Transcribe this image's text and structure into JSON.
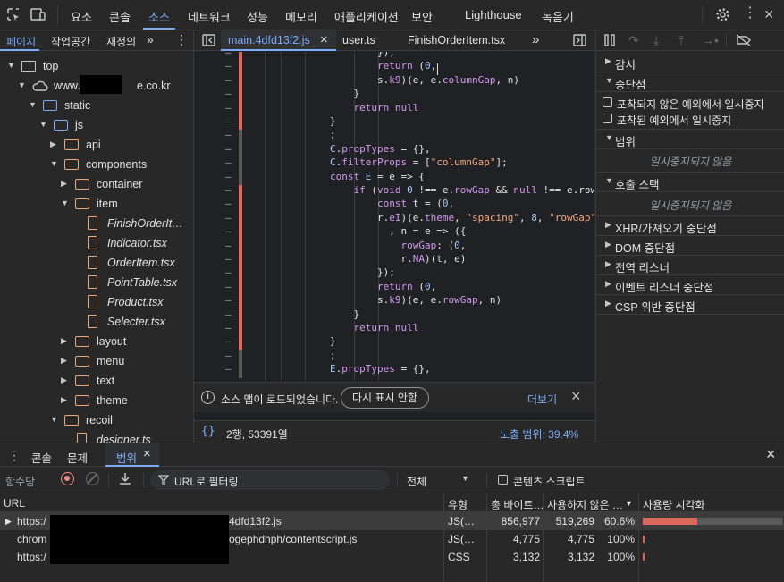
{
  "topbar": {
    "tabs": [
      "요소",
      "콘솔",
      "소스",
      "네트워크",
      "성능",
      "메모리",
      "애플리케이션",
      "보안",
      "Lighthouse",
      "녹음기"
    ],
    "active_tab": "소스"
  },
  "navigator": {
    "tabs": [
      "페이지",
      "작업공간",
      "재정의"
    ],
    "more": "»",
    "tree": [
      {
        "label": "top",
        "depth": 0,
        "kind": "frame",
        "arrow": "▼"
      },
      {
        "label": "www.",
        "suffix": "e.co.kr",
        "depth": 1,
        "kind": "cloud",
        "arrow": "▼"
      },
      {
        "label": "static",
        "depth": 2,
        "kind": "folder-blue",
        "arrow": "▼"
      },
      {
        "label": "js",
        "depth": 3,
        "kind": "folder-blue",
        "arrow": "▼"
      },
      {
        "label": "api",
        "depth": 4,
        "kind": "folder",
        "arrow": "▶"
      },
      {
        "label": "components",
        "depth": 4,
        "kind": "folder",
        "arrow": "▼"
      },
      {
        "label": "container",
        "depth": 5,
        "kind": "folder",
        "arrow": "▶"
      },
      {
        "label": "item",
        "depth": 5,
        "kind": "folder",
        "arrow": "▼"
      },
      {
        "label": "FinishOrderIt…",
        "depth": 6,
        "kind": "file"
      },
      {
        "label": "Indicator.tsx",
        "depth": 6,
        "kind": "file"
      },
      {
        "label": "OrderItem.tsx",
        "depth": 6,
        "kind": "file"
      },
      {
        "label": "PointTable.tsx",
        "depth": 6,
        "kind": "file"
      },
      {
        "label": "Product.tsx",
        "depth": 6,
        "kind": "file"
      },
      {
        "label": "Selecter.tsx",
        "depth": 6,
        "kind": "file"
      },
      {
        "label": "layout",
        "depth": 5,
        "kind": "folder",
        "arrow": "▶"
      },
      {
        "label": "menu",
        "depth": 5,
        "kind": "folder",
        "arrow": "▶"
      },
      {
        "label": "text",
        "depth": 5,
        "kind": "folder",
        "arrow": "▶"
      },
      {
        "label": "theme",
        "depth": 5,
        "kind": "folder",
        "arrow": "▶"
      },
      {
        "label": "recoil",
        "depth": 4,
        "kind": "folder",
        "arrow": "▼"
      },
      {
        "label": "designer.ts",
        "depth": 5,
        "kind": "file"
      }
    ]
  },
  "editor": {
    "tabs": [
      {
        "label": "main.4dfd13f2.js",
        "closable": "×"
      },
      {
        "label": "user.ts"
      },
      {
        "label": "FinishOrderItem.tsx"
      }
    ],
    "more": "»",
    "lines": [
      "                });",
      "                return (0,",
      "                s.k9)(e, e.columnGap, n)",
      "            }",
      "            return null",
      "        }",
      "        ;",
      "        C.propTypes = {},",
      "        C.filterProps = [\"columnGap\"];",
      "        const E = e => {",
      "            if (void 0 !== e.rowGap && null !== e.row",
      "                const t = (0,",
      "                r.eI)(e.theme, \"spacing\", 8, \"rowGap\"",
      "                  , n = e => ({",
      "                    rowGap: (0,",
      "                    r.NA)(t, e)",
      "                });",
      "                return (0,",
      "                s.k9)(e, e.rowGap, n)",
      "            }",
      "            return null",
      "        }",
      "        ;",
      "        E.propTypes = {},"
    ],
    "dash": "–",
    "notice": {
      "text": "소스 맵이 로드되었습니다.",
      "button": "다시 표시 안함",
      "link": "더보기",
      "close": "×"
    },
    "status": {
      "braces": "{}",
      "position": "2행, 53391열",
      "coverage": "노출 범위: 39.4%"
    }
  },
  "debugger": {
    "sections": [
      {
        "label": "감시",
        "arrow": "▶"
      },
      {
        "label": "중단점",
        "arrow": "▼"
      },
      {
        "label": "범위",
        "arrow": "▼"
      },
      {
        "label": "호출 스택",
        "arrow": "▼"
      },
      {
        "label": "XHR/가져오기 중단점",
        "arrow": "▶"
      },
      {
        "label": "DOM 중단점",
        "arrow": "▶"
      },
      {
        "label": "전역 리스너",
        "arrow": "▶"
      },
      {
        "label": "이벤트 리스너 중단점",
        "arrow": "▶"
      },
      {
        "label": "CSP 위반 중단점",
        "arrow": "▶"
      }
    ],
    "checkboxes": [
      "포착되지 않은 예외에서 일시중지",
      "포착된 예외에서 일시중지"
    ],
    "not_paused": "일시중지되지 않음"
  },
  "drawer": {
    "tabs": [
      "콘솔",
      "문제",
      "범위"
    ],
    "active_tab": "범위",
    "close": "×",
    "toolbar": {
      "mode": "함수당",
      "filter_placeholder": "URL로 필터링",
      "type_select": "전체",
      "content_scripts": "콘텐츠 스크립트"
    },
    "columns": [
      "URL",
      "유형",
      "총 바이트…",
      "사용하지 않은 …",
      "사용량 시각화"
    ],
    "rows": [
      {
        "url_start": "https:/",
        "url_end": "4dfd13f2.js",
        "type": "JS(…",
        "total": "856,977",
        "unused": "519,269",
        "percent": "60.6%",
        "used_fraction": 0.394
      },
      {
        "url_start": "chrom",
        "url_end": "ogephdhph/contentscript.js",
        "type": "JS(…",
        "total": "4,775",
        "unused": "4,775",
        "percent": "100%",
        "used_fraction": 0.0
      },
      {
        "url_start": "https:/",
        "url_end": "",
        "type": "CSS",
        "total": "3,132",
        "unused": "3,132",
        "percent": "100%",
        "used_fraction": 0.0
      }
    ]
  },
  "colors": {
    "accent": "#7cacf8",
    "coverage_used": "#e0675c",
    "coverage_unused": "#5b5b5b",
    "folder": "#e8a87c"
  }
}
